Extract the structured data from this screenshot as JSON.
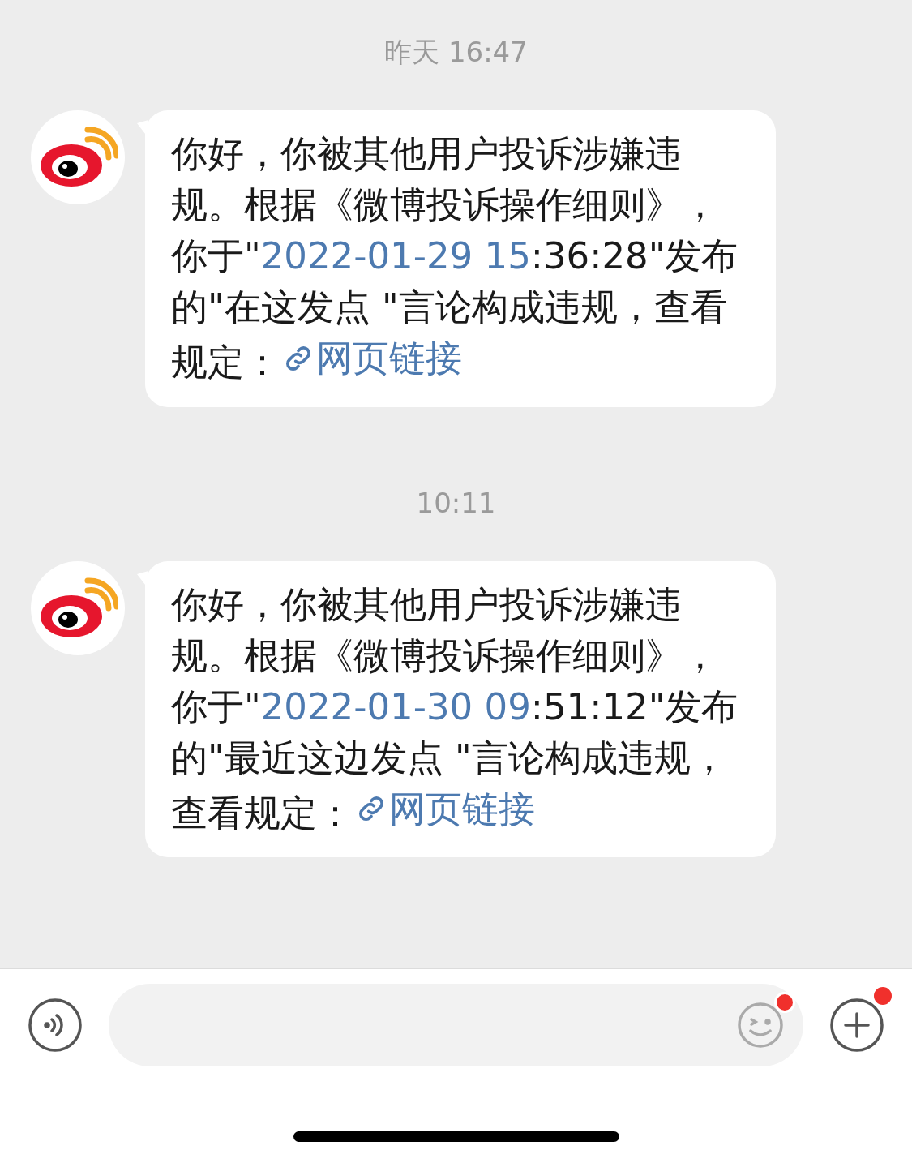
{
  "conversation": [
    {
      "kind": "time",
      "text": "昨天 16:47"
    },
    {
      "kind": "message",
      "segments": [
        {
          "kind": "text",
          "text": "你好，你被其他用户投诉涉嫌违规。根据《微博投诉操作细则》，你于\""
        },
        {
          "kind": "date-link",
          "text": "2022-01-29 15"
        },
        {
          "kind": "text",
          "text": ":36:28\"发布的\"在这发点 \"言论构成违规，查看规定："
        },
        {
          "kind": "web-link",
          "text": "网页链接"
        }
      ]
    },
    {
      "kind": "time",
      "text": "10:11"
    },
    {
      "kind": "message",
      "segments": [
        {
          "kind": "text",
          "text": "你好，你被其他用户投诉涉嫌违规。根据《微博投诉操作细则》，你于\""
        },
        {
          "kind": "date-link",
          "text": "2022-01-30 09"
        },
        {
          "kind": "text",
          "text": ":51:12\"发布的\"最近这边发点 \"言论构成违规，查看规定："
        },
        {
          "kind": "web-link",
          "text": "网页链接"
        }
      ]
    }
  ],
  "input_bar": {
    "emoji_dot": true,
    "plus_dot": true
  }
}
